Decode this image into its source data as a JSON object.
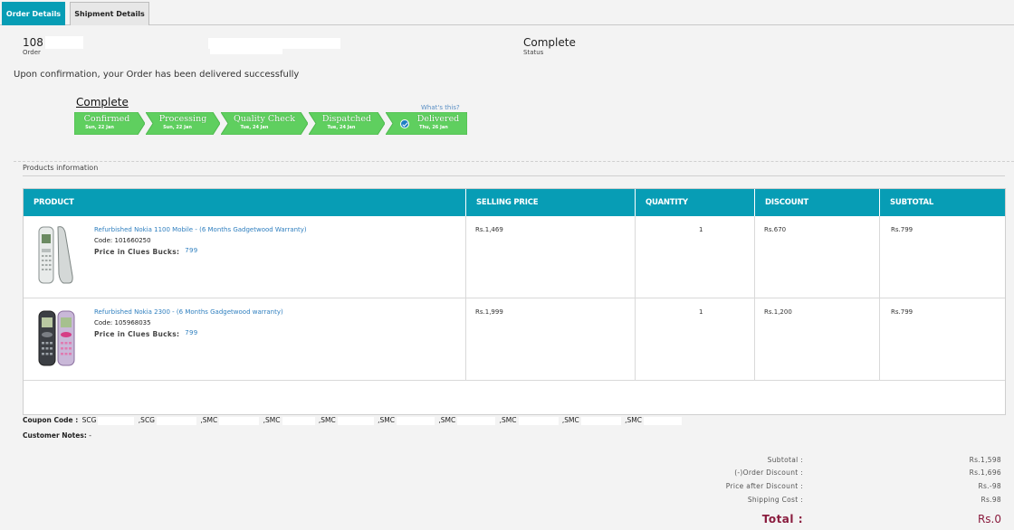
{
  "tabs": [
    {
      "label": "Order Details",
      "active": true
    },
    {
      "label": "Shipment Details",
      "active": false
    }
  ],
  "order": {
    "number": "108",
    "number_label": "Order",
    "status": "Complete",
    "status_label": "Status",
    "confirmation_message": "Upon confirmation, your Order has been delivered successfully"
  },
  "tracker": {
    "title": "Complete",
    "help_link": "What's this?",
    "steps": [
      {
        "label": "Confirmed",
        "date": "Sun, 22 Jan"
      },
      {
        "label": "Processing",
        "date": "Sun, 22 Jan"
      },
      {
        "label": "Quality Check",
        "date": "Tue, 24 Jan"
      },
      {
        "label": "Dispatched",
        "date": "Tue, 24 Jan"
      },
      {
        "label": "Delivered",
        "date": "Thu, 26 Jan"
      }
    ]
  },
  "products_section": {
    "title": "Products information",
    "headers": [
      "PRODUCT",
      "SELLING PRICE",
      "QUANTITY",
      "DISCOUNT",
      "SUBTOTAL"
    ],
    "bucks_label": "Price in Clues Bucks:",
    "rows": [
      {
        "name": "Refurbished Nokia 1100 Mobile - (6 Months Gadgetwood Warranty)",
        "code": "Code: 101660250",
        "bucks": "799",
        "selling_price": "Rs.1,469",
        "quantity": "1",
        "discount": "Rs.670",
        "subtotal": "Rs.799"
      },
      {
        "name": "Refurbished Nokia 2300 - (6 Months Gadgetwood warranty)",
        "code": "Code: 105968035",
        "bucks": "799",
        "selling_price": "Rs.1,999",
        "quantity": "1",
        "discount": "Rs.1,200",
        "subtotal": "Rs.799"
      }
    ]
  },
  "coupons": {
    "label": "Coupon Code :",
    "codes": [
      "SCG",
      ",SCG",
      ",SMC",
      ",SMC",
      ",SMC",
      ",SMC",
      ",SMC",
      ",SMC",
      ",SMC",
      ",SMC"
    ]
  },
  "notes": {
    "label": "Customer Notes:",
    "value": "-"
  },
  "totals": {
    "subtotal_label": "Subtotal :",
    "subtotal": "Rs.1,598",
    "order_discount_label": "(-)Order Discount :",
    "order_discount": "Rs.1,696",
    "after_discount_label": "Price after Discount :",
    "after_discount": "Rs.-98",
    "shipping_label": "Shipping Cost :",
    "shipping": "Rs.98",
    "total_label": "Total :",
    "total": "Rs.0"
  },
  "colors": {
    "accent": "#079db5",
    "step_green": "#5fcf5f",
    "link": "#2f7fbf",
    "total": "#8a1c3e"
  }
}
